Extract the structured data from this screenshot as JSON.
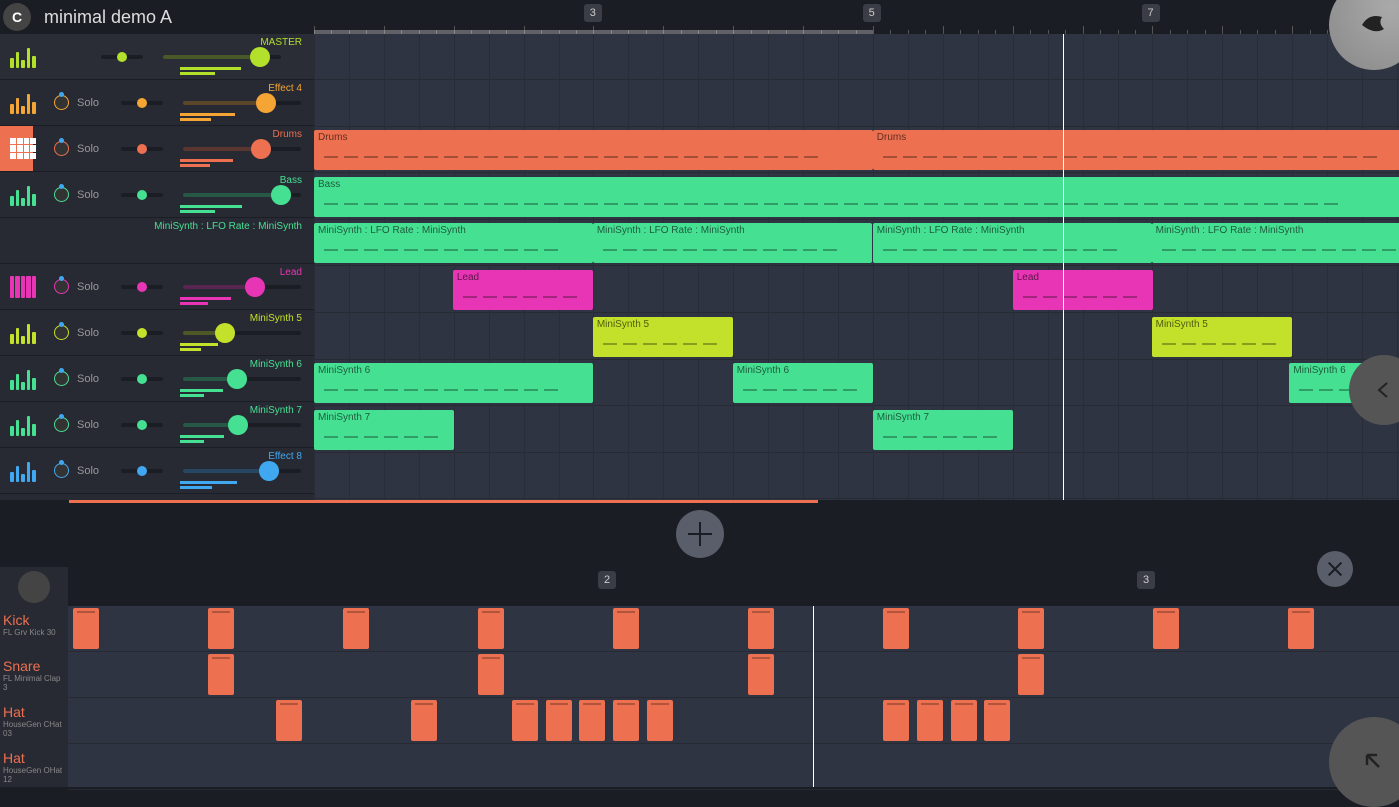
{
  "header": {
    "title": "minimal demo A"
  },
  "ruler_markers": [
    3,
    5,
    7
  ],
  "playhead_percent": 69,
  "tracks": [
    {
      "name": "MASTER",
      "color": "#b3e02a",
      "solo": false,
      "vol": 82,
      "type": "master",
      "icon": "eq"
    },
    {
      "name": "Effect 4",
      "color": "#f5a534",
      "solo": true,
      "vol": 70,
      "type": "fx",
      "icon": "eq"
    },
    {
      "name": "Drums",
      "color": "#ed7050",
      "solo": true,
      "vol": 66,
      "type": "drums",
      "icon": "grid",
      "selected": true
    },
    {
      "name": "Bass",
      "color": "#46e093",
      "solo": true,
      "vol": 83,
      "type": "synth",
      "icon": "eq"
    },
    {
      "name": "MiniSynth : LFO Rate : MiniSynth",
      "color": "#46e093",
      "solo": false,
      "vol": 0,
      "type": "auto",
      "icon": "none"
    },
    {
      "name": "Lead",
      "color": "#e835b5",
      "solo": true,
      "vol": 61,
      "type": "synth",
      "icon": "keys"
    },
    {
      "name": "MiniSynth 5",
      "color": "#c3e02a",
      "solo": true,
      "vol": 36,
      "type": "synth",
      "icon": "eq"
    },
    {
      "name": "MiniSynth 6",
      "color": "#46e093",
      "solo": true,
      "vol": 46,
      "type": "synth",
      "icon": "eq"
    },
    {
      "name": "MiniSynth 7",
      "color": "#46e093",
      "solo": true,
      "vol": 47,
      "type": "synth",
      "icon": "eq"
    },
    {
      "name": "Effect 8",
      "color": "#40a8f0",
      "solo": true,
      "vol": 73,
      "type": "fx",
      "icon": "eq"
    }
  ],
  "clips": [
    {
      "track": 2,
      "start": 0,
      "len": 51.5,
      "label": "Drums",
      "color": "#ed7050"
    },
    {
      "track": 2,
      "start": 51.5,
      "len": 51.5,
      "label": "Drums",
      "color": "#ed7050"
    },
    {
      "track": 3,
      "start": 0,
      "len": 103,
      "label": "Bass",
      "color": "#46e093"
    },
    {
      "track": 4,
      "start": 0,
      "len": 25.7,
      "label": "MiniSynth : LFO Rate : MiniSynth",
      "color": "#46e093"
    },
    {
      "track": 4,
      "start": 25.7,
      "len": 25.7,
      "label": "MiniSynth : LFO Rate : MiniSynth",
      "color": "#46e093"
    },
    {
      "track": 4,
      "start": 51.5,
      "len": 25.7,
      "label": "MiniSynth : LFO Rate : MiniSynth",
      "color": "#46e093"
    },
    {
      "track": 4,
      "start": 77.2,
      "len": 25.7,
      "label": "MiniSynth : LFO Rate : MiniSynth",
      "color": "#46e093"
    },
    {
      "track": 5,
      "start": 12.8,
      "len": 12.9,
      "label": "Lead",
      "color": "#e835b5"
    },
    {
      "track": 5,
      "start": 64.4,
      "len": 12.9,
      "label": "Lead",
      "color": "#e835b5"
    },
    {
      "track": 6,
      "start": 25.7,
      "len": 12.9,
      "label": "MiniSynth 5",
      "color": "#c3e02a"
    },
    {
      "track": 6,
      "start": 77.2,
      "len": 12.9,
      "label": "MiniSynth 5",
      "color": "#c3e02a"
    },
    {
      "track": 7,
      "start": 0,
      "len": 25.7,
      "label": "MiniSynth 6",
      "color": "#46e093"
    },
    {
      "track": 7,
      "start": 38.6,
      "len": 12.9,
      "label": "MiniSynth 6",
      "color": "#46e093"
    },
    {
      "track": 7,
      "start": 89.9,
      "len": 12.9,
      "label": "MiniSynth 6",
      "color": "#46e093"
    },
    {
      "track": 8,
      "start": 0,
      "len": 12.9,
      "label": "MiniSynth 7",
      "color": "#46e093"
    },
    {
      "track": 8,
      "start": 51.5,
      "len": 12.9,
      "label": "MiniSynth 7",
      "color": "#46e093"
    }
  ],
  "drum_ruler_markers": [
    2,
    3
  ],
  "drums": [
    {
      "name": "Kick",
      "sub": "FL Grv Kick 30",
      "steps": [
        0,
        2,
        4,
        6,
        8,
        10,
        12,
        14,
        16,
        18
      ]
    },
    {
      "name": "Snare",
      "sub": "FL Minimal Clap 3",
      "steps": [
        2,
        6,
        10,
        14
      ]
    },
    {
      "name": "Hat",
      "sub": "HouseGen CHat 03",
      "steps": [
        3,
        5,
        6.5,
        7,
        7.5,
        8,
        8.5,
        12,
        12.5,
        13,
        13.5
      ]
    },
    {
      "name": "Hat",
      "sub": "HouseGen OHat 12",
      "steps": []
    }
  ],
  "drum_playhead_percent": 56,
  "labels": {
    "solo": "Solo"
  }
}
